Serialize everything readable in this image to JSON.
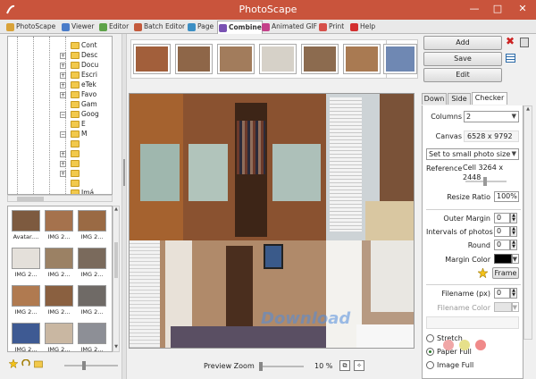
{
  "window": {
    "title": "PhotoScape",
    "min": "—",
    "max": "□",
    "close": "✕"
  },
  "tabs": [
    {
      "label": "PhotoScape",
      "color": "#d9a33a"
    },
    {
      "label": "Viewer",
      "color": "#4a7cc9"
    },
    {
      "label": "Editor",
      "color": "#5ea34a"
    },
    {
      "label": "Batch Editor",
      "color": "#c45a3c"
    },
    {
      "label": "Page",
      "color": "#3c8fc4"
    },
    {
      "label": "Combine",
      "color": "#7a52b3"
    },
    {
      "label": "Animated GIF",
      "color": "#c4418a"
    },
    {
      "label": "Print",
      "color": "#d6504a"
    },
    {
      "label": "Help",
      "color": "#d32f2f"
    }
  ],
  "tree": [
    {
      "label": "Cont",
      "exp": ""
    },
    {
      "label": "Desc",
      "exp": "+"
    },
    {
      "label": "Docu",
      "exp": "+"
    },
    {
      "label": "Escri",
      "exp": "+"
    },
    {
      "label": "eTek",
      "exp": "+"
    },
    {
      "label": "Favo",
      "exp": "+"
    },
    {
      "label": "Gam",
      "exp": ""
    },
    {
      "label": "Goog",
      "exp": "−"
    },
    {
      "label": "E",
      "exp": ""
    },
    {
      "label": "M",
      "exp": "−"
    },
    {
      "label": "",
      "exp": ""
    },
    {
      "label": "",
      "exp": "+"
    },
    {
      "label": "",
      "exp": "+"
    },
    {
      "label": "",
      "exp": "+"
    },
    {
      "label": "",
      "exp": ""
    },
    {
      "label": "Imá",
      "exp": ""
    }
  ],
  "thumbs": [
    {
      "caption": "Avatar....",
      "color": "#7d5a3f"
    },
    {
      "caption": "IMG 2...",
      "color": "#a5724d"
    },
    {
      "caption": "IMG 2...",
      "color": "#9a6a44"
    },
    {
      "caption": "IMG 2...",
      "color": "#e4e0da"
    },
    {
      "caption": "IMG 2...",
      "color": "#9b8164"
    },
    {
      "caption": "IMG 2...",
      "color": "#7a6a5c"
    },
    {
      "caption": "IMG 2...",
      "color": "#b07a50"
    },
    {
      "caption": "IMG 2...",
      "color": "#8a6040"
    },
    {
      "caption": "IMG 2...",
      "color": "#6f6a66"
    },
    {
      "caption": "IMG 2...",
      "color": "#3e5a93"
    },
    {
      "caption": "IMG 2...",
      "color": "#c9b7a2"
    },
    {
      "caption": "IMG 2...",
      "color": "#8d8f96"
    }
  ],
  "strip": [
    "#a25f3b",
    "#8e6648",
    "#a27c5c",
    "#d6d1c8",
    "#8c6b4f",
    "#a97a52",
    "#6f88b3"
  ],
  "zoom": {
    "label": "Preview Zoom",
    "value": "10 %",
    "fraction": 0.0,
    "fit_icon": "⧉",
    "full_icon": "✧"
  },
  "actions": {
    "add": "Add",
    "save": "Save",
    "edit": "Edit"
  },
  "panel": {
    "tabs": [
      "Down",
      "Side",
      "Checker"
    ],
    "columns_label": "Columns",
    "columns_value": "2",
    "canvas_label": "Canvas",
    "canvas_value": "6528 x 9792",
    "size_mode": "Set to small photo size",
    "reference_label": "Reference",
    "reference_value": "Cell 3264 x 2448",
    "resize_label": "Resize Ratio",
    "resize_value": "100%",
    "outer_margin_label": "Outer Margin",
    "outer_margin_value": "0",
    "intervals_label": "Intervals of photos",
    "intervals_value": "0",
    "round_label": "Round",
    "round_value": "0",
    "margin_color_label": "Margin Color",
    "margin_color": "#000000",
    "frame_label": "Frame",
    "filename_label": "Filename (px)",
    "filename_value": "0",
    "filename_color_label": "Filename Color",
    "options": [
      "Stretch",
      "Paper Full",
      "Image Full"
    ],
    "selected_option": "Paper Full"
  },
  "watermark": "Download",
  "colors": {
    "titlebar": "#c9543c",
    "accent": "#2a7a2a"
  }
}
